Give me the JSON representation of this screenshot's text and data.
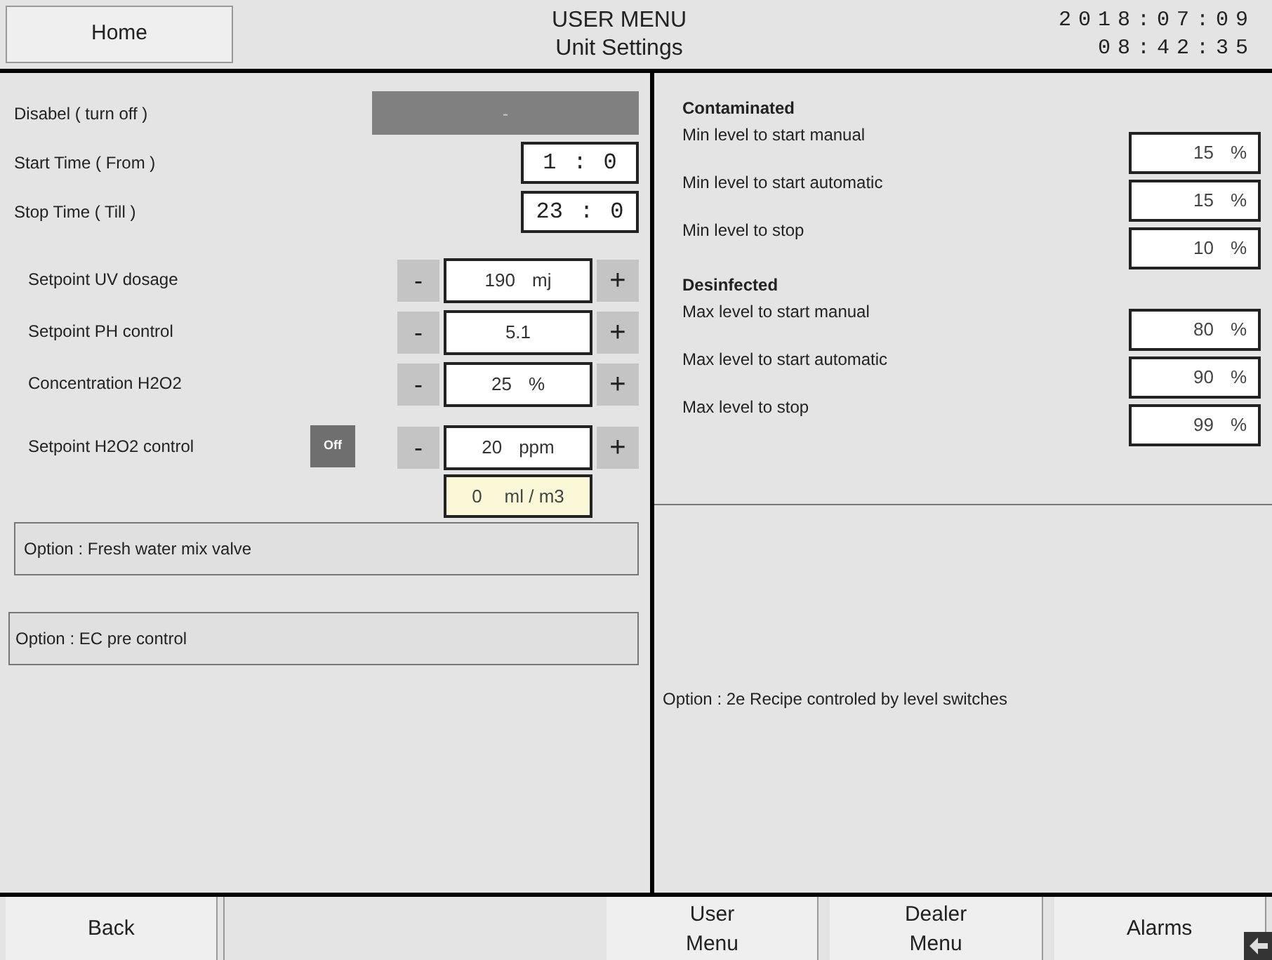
{
  "header": {
    "home_button": "Home",
    "title": "USER MENU",
    "subtitle": "Unit Settings",
    "date": "2018:07:09",
    "time": "08:42:35"
  },
  "left": {
    "disable": {
      "label": "Disabel ( turn off )",
      "value": "-"
    },
    "times": [
      {
        "label": "Start Time ( From )",
        "hours": "1",
        "separator": ":",
        "minutes": "0"
      },
      {
        "label": "Stop Time ( Till )",
        "hours": "23",
        "separator": ":",
        "minutes": "0"
      }
    ],
    "setpoints": [
      {
        "label": "Setpoint UV dosage",
        "decrement": "-",
        "value": "190",
        "unit": "mj",
        "increment": "+"
      },
      {
        "label": "Setpoint PH control",
        "decrement": "-",
        "value": "5.1",
        "increment": "+"
      },
      {
        "label": "Concentration H2O2",
        "decrement": "-",
        "value": "25",
        "unit": "%",
        "increment": "+"
      },
      {
        "label": "Setpoint H2O2 control",
        "toggle": "Off",
        "decrement": "-",
        "value": "20",
        "unit": "ppm",
        "increment": "+",
        "sub_value": "0",
        "sub_unit": "ml / m3"
      }
    ],
    "options": [
      "Option : Fresh water mix valve",
      "Option : EC pre control"
    ]
  },
  "right": {
    "groups": [
      {
        "title": "Contaminated",
        "rows": [
          {
            "label": "Min level to start manual",
            "value": "15",
            "unit": "%"
          },
          {
            "label": "Min level to start automatic",
            "value": "15",
            "unit": "%"
          },
          {
            "label": "Min level to stop",
            "value": "10",
            "unit": "%"
          }
        ]
      },
      {
        "title": "Desinfected",
        "rows": [
          {
            "label": "Max level to start manual",
            "value": "80",
            "unit": "%"
          },
          {
            "label": "Max level to start automatic",
            "value": "90",
            "unit": "%"
          },
          {
            "label": "Max level to stop",
            "value": "99",
            "unit": "%"
          }
        ]
      }
    ],
    "note": "Option : 2e Recipe controled by level switches"
  },
  "footer": [
    {
      "kind": "button",
      "label": "Back"
    },
    {
      "kind": "blank"
    },
    {
      "kind": "button",
      "label": "User\nMenu"
    },
    {
      "kind": "button",
      "label": "Dealer\nMenu"
    },
    {
      "kind": "button",
      "label": "Alarms"
    }
  ]
}
